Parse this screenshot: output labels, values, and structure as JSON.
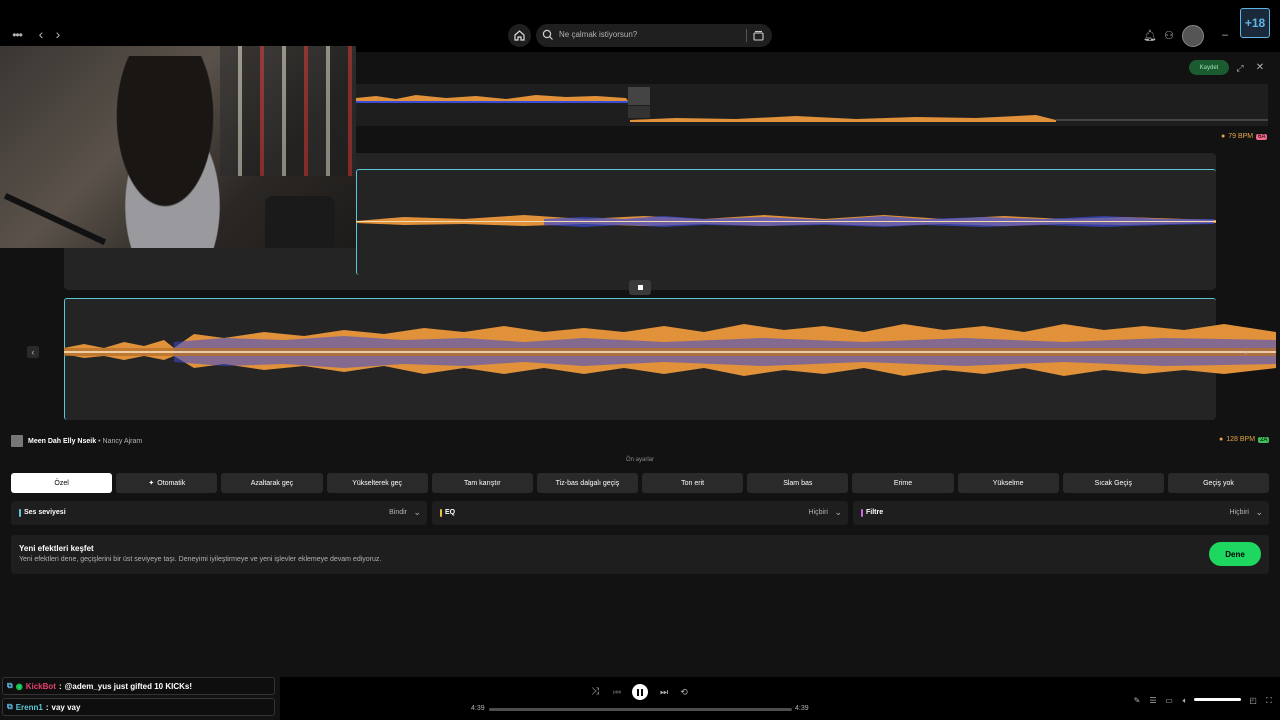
{
  "header": {
    "search_placeholder": "Ne çalmak istiyorsun?",
    "save_label": "Kaydet"
  },
  "track_a": {
    "bpm": "79 BPM",
    "key": "6A",
    "key_color": "#f06b8a"
  },
  "track_b": {
    "title": "Meen Dah Elly Nseik",
    "separator": "•",
    "artist": "Nancy Ajram",
    "bpm": "128 BPM",
    "key": "2A",
    "key_color": "#3fbf5a"
  },
  "presets_header": "Ön ayarlar",
  "presets": [
    {
      "label": "Özel",
      "active": true
    },
    {
      "label": "Otomatik",
      "icon": "sparkle-icon"
    },
    {
      "label": "Azaltarak geç"
    },
    {
      "label": "Yükselterek geç"
    },
    {
      "label": "Tam karıştır"
    },
    {
      "label": "Tiz-bas dalgalı geçiş"
    },
    {
      "label": "Ton erit"
    },
    {
      "label": "Slam bas"
    },
    {
      "label": "Erime"
    },
    {
      "label": "Yükselme"
    },
    {
      "label": "Sıcak Geçiş"
    },
    {
      "label": "Geçiş yok"
    }
  ],
  "controls": [
    {
      "label": "Ses seviyesi",
      "value": "Bindir",
      "color": "#5cc7d6"
    },
    {
      "label": "EQ",
      "value": "Hiçbiri",
      "color": "#e6c04a"
    },
    {
      "label": "Filtre",
      "value": "Hiçbiri",
      "color": "#c86be0"
    }
  ],
  "promo": {
    "title": "Yeni efektleri keşfet",
    "text": "Yeni efektleri dene, geçişlerini bir üst seviyeye taşı. Deneyimi iyileştirmeye ve yeni işlevler eklemeye devam ediyoruz.",
    "button": "Dene"
  },
  "chat": [
    {
      "user": "KickBot",
      "message": "@adem_yus just gifted 10 KICKs!",
      "user_color": "#e6406b"
    },
    {
      "user": "Erenn1",
      "message": "vay vay",
      "user_color": "#5cc7d6"
    }
  ],
  "player": {
    "elapsed": "4:39",
    "total": "4:39",
    "progress": 0.0
  },
  "colors": {
    "accent_green": "#1ed760",
    "waveform_orange": "#e0913a",
    "waveform_blue": "#3a4bd6",
    "selection": "#5cc7d6"
  }
}
